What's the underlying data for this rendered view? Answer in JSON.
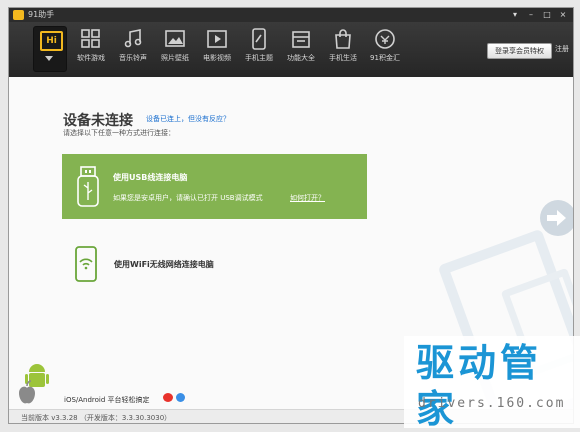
{
  "window": {
    "title": "91助手"
  },
  "toolbar": {
    "items": [
      {
        "label": "软件游戏",
        "icon": "apps-grid-icon"
      },
      {
        "label": "音乐铃声",
        "icon": "music-note-icon"
      },
      {
        "label": "照片壁纸",
        "icon": "photo-icon"
      },
      {
        "label": "电影视频",
        "icon": "video-icon"
      },
      {
        "label": "手机主题",
        "icon": "phone-theme-icon"
      },
      {
        "label": "功能大全",
        "icon": "toolbox-icon"
      },
      {
        "label": "手机生活",
        "icon": "shopping-bag-icon"
      },
      {
        "label": "91积金汇",
        "icon": "coin-icon"
      }
    ],
    "hi_label": "Hi",
    "login_label": "登录享会员特权",
    "register_label": "注册"
  },
  "content": {
    "heading": "设备未连接",
    "help_link": "设备已连上，但没有反应？",
    "subtext": "请选择以下任意一种方式进行连接：",
    "usb": {
      "title": "使用USB线连接电脑",
      "desc": "如果您是安卓用户，请确认已打开 USB调试模式",
      "link": "如何打开？"
    },
    "wifi": {
      "title": "使用WiFi无线网络连接电脑"
    },
    "platform_text": "iOS/Android 平台轻松搞定"
  },
  "status": {
    "text": "当前版本 v3.3.28 （开发版本：3.3.30.3030）"
  },
  "watermark": {
    "title": "驱动管家",
    "url": "drivers.160.com"
  },
  "colors": {
    "accent_green": "#84b351",
    "toolbar_dark": "#2c2c2c",
    "hi_yellow": "#f2b81f",
    "link_blue": "#1a6fcf",
    "watermark_blue": "#1b95d5"
  }
}
